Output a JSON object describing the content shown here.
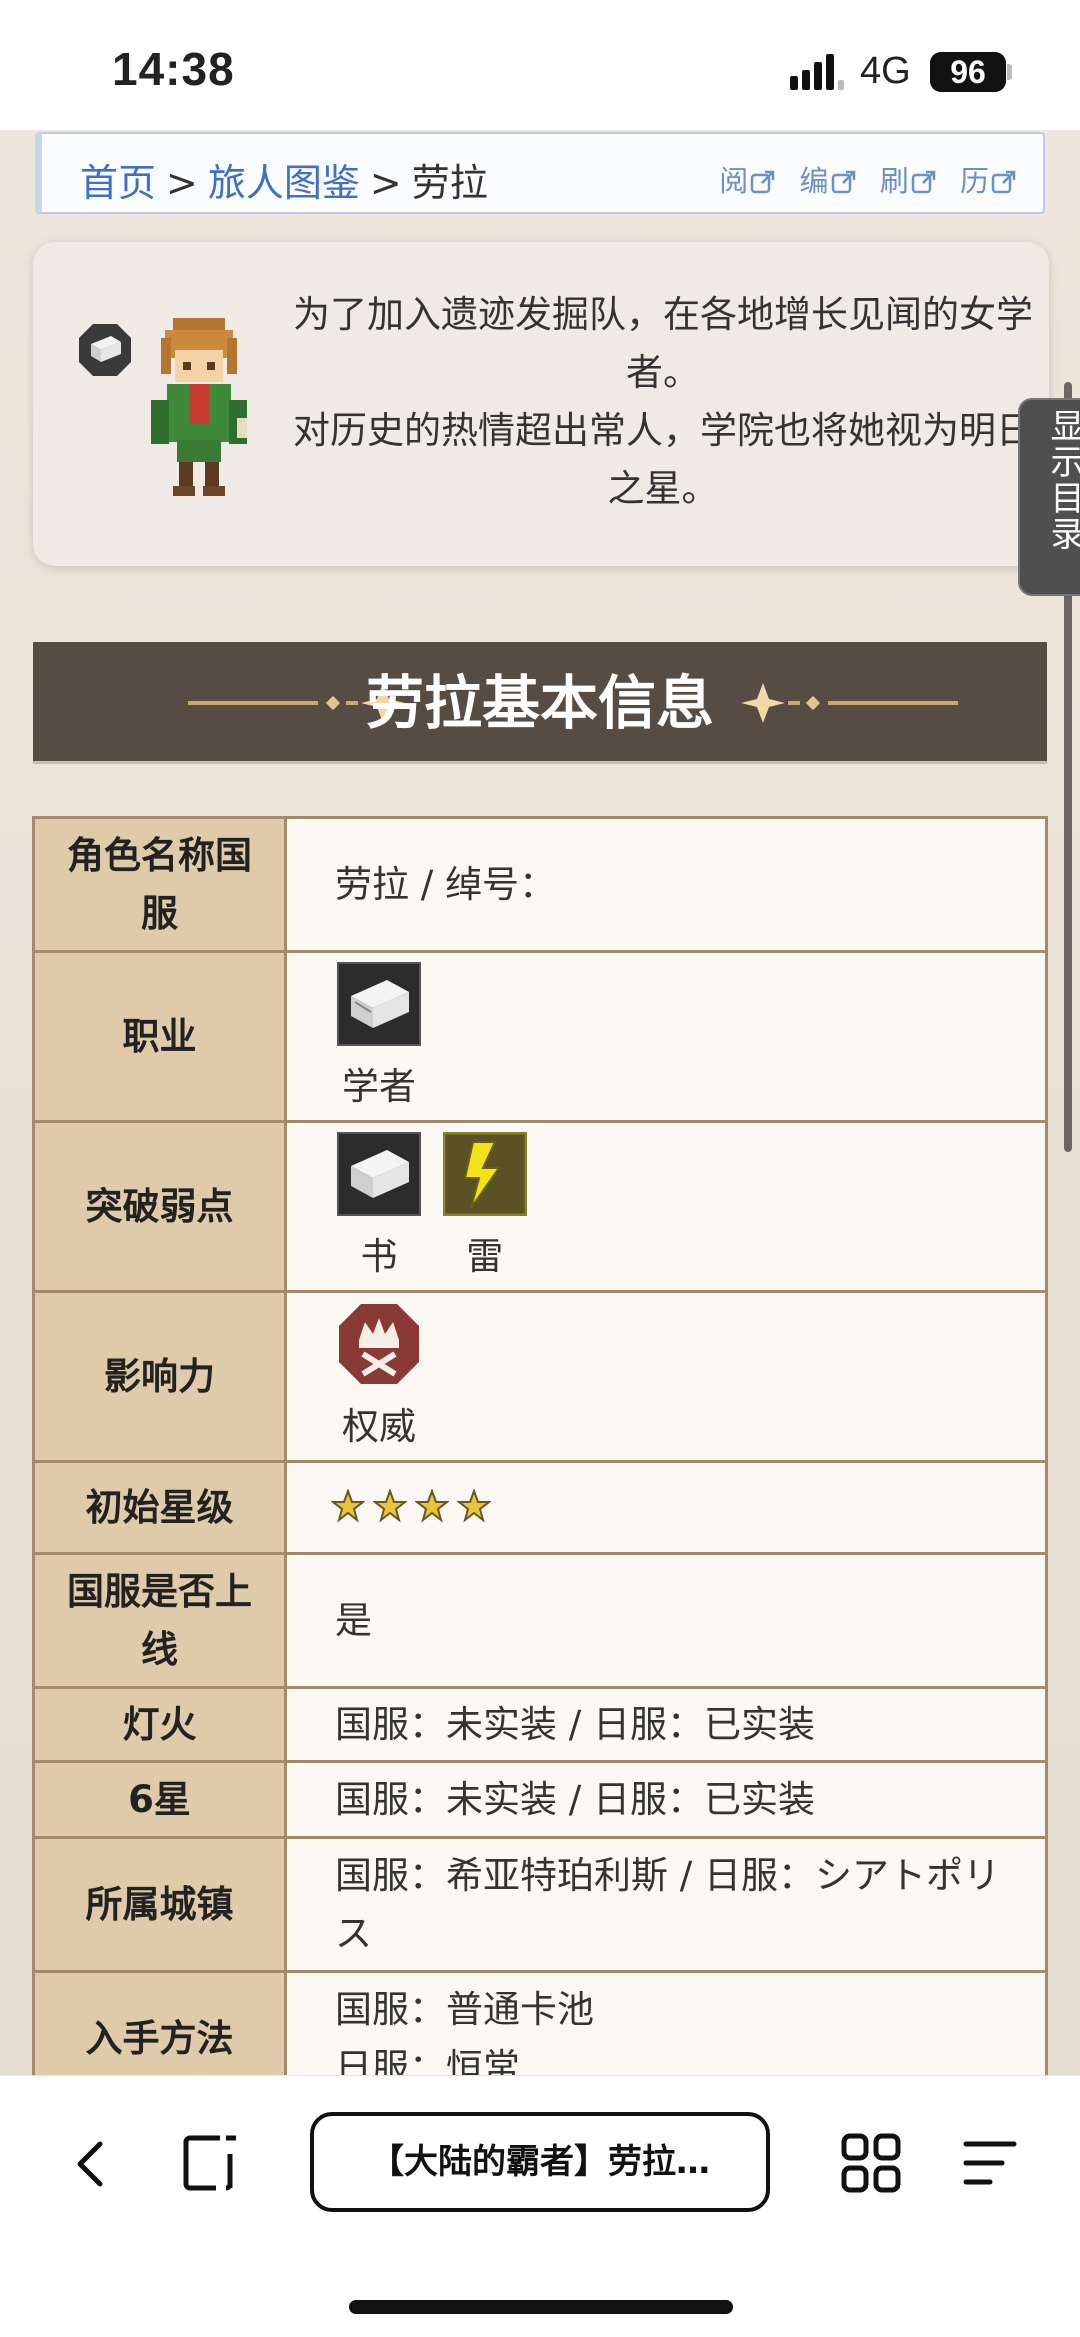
{
  "status_bar": {
    "time": "14:38",
    "network": "4G",
    "battery": "96"
  },
  "breadcrumb": {
    "items": [
      "首页",
      "旅人图鉴"
    ],
    "separator": ">",
    "current": "劳拉",
    "actions": [
      "阅",
      "编",
      "刷",
      "历"
    ]
  },
  "intro": {
    "line1": "为了加入遗迹发掘队，在各地增长见闻的女学者。",
    "line2": "对历史的热情超出常人，学院也将她视为明日之星。"
  },
  "toc_tab": "显示目录",
  "section": {
    "title": "劳拉基本信息"
  },
  "info": {
    "name_key": "角色名称国服",
    "name_val": "劳拉 / 绰号：",
    "job_key": "职业",
    "job_label": "学者",
    "weak_key": "突破弱点",
    "weak_labels": [
      "书",
      "雷"
    ],
    "influence_key": "影响力",
    "influence_label": "权威",
    "star_key": "初始星级",
    "star_count": 4,
    "online_key": "国服是否上线",
    "online_val": "是",
    "fire_key": "灯火",
    "fire_val": "国服：未实装 / 日服：已实装",
    "six_key": "6星",
    "six_val": "国服：未实装 / 日服：已实装",
    "town_key": "所属城镇",
    "town_val": "国服：希亚特珀利斯 / 日服：シアトポリス",
    "obtain_key": "入手方法",
    "obtain_line1": "国服：普通卡池",
    "obtain_line2": "日服：恒常"
  },
  "toolbar": {
    "tab_title": "【大陆的霸者】劳拉…"
  },
  "colors": {
    "link": "#3d6fc4",
    "table_key_bg": "#dfcbaa",
    "table_border": "#a38a6c",
    "section_header_bg": "#574c43"
  }
}
